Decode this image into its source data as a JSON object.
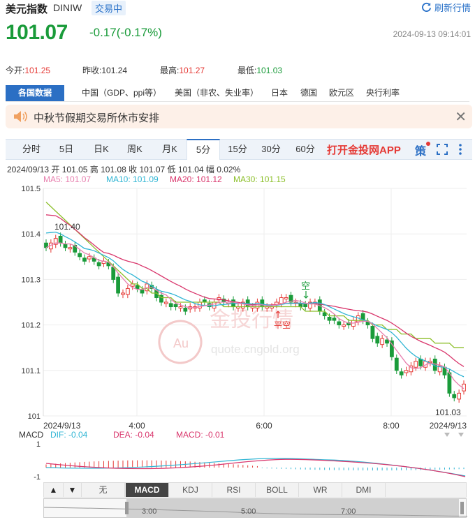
{
  "header": {
    "name": "美元指数",
    "code": "DINIW",
    "status": "交易中",
    "refresh_label": "刷新行情",
    "price": "101.07",
    "change": "-0.17(-0.17%)",
    "timestamp": "2024-09-13 09:14:01"
  },
  "stats": {
    "open_label": "今开:",
    "open": "101.25",
    "prev_label": "昨收:",
    "prev": "101.24",
    "high_label": "最高:",
    "high": "101.27",
    "low_label": "最低:",
    "low": "101.03"
  },
  "data_tabs": [
    "各国数据",
    "中国（GDP、ppi等）",
    "美国（非农、失业率）",
    "日本",
    "德国",
    "欧元区",
    "央行利率"
  ],
  "notice": {
    "text": "中秋节假期交易所休市安排"
  },
  "period_tabs": [
    "分时",
    "5日",
    "日K",
    "周K",
    "月K",
    "5分",
    "15分",
    "30分",
    "60分"
  ],
  "active_period": "5分",
  "app_link": "打开金投网APP",
  "strategy_label": "策",
  "bar_info": "2024/09/13  开 101.05  高 101.08  收 101.07  低 101.04  幅 0.02%",
  "ma_legend": {
    "ma5": "MA5: 101.07",
    "ma10": "MA10: 101.09",
    "ma20": "MA20: 101.12",
    "ma30": "MA30: 101.15"
  },
  "colors": {
    "up": "#e53935",
    "down": "#1a9b3a",
    "ma5": "#e77fae",
    "ma10": "#2fb5d4",
    "ma20": "#d9366c",
    "ma30": "#8cbf2a",
    "accent": "#2b6fc4"
  },
  "chart_data": {
    "type": "candlestick",
    "y_ticks": [
      "101.5",
      "101.4",
      "101.3",
      "101.2",
      "101.1",
      "101"
    ],
    "ylim": [
      101.0,
      101.5
    ],
    "x_labels": [
      "2024/9/13",
      "4:00",
      "6:00",
      "8:00",
      "2024/9/13"
    ],
    "annotations": {
      "max_label": "101.40",
      "min_label": "101.03",
      "signal_short": "空",
      "signal_flat": "平空"
    },
    "watermark": "金投行情",
    "watermark_url": "quote.cngold.org",
    "closes": [
      101.37,
      101.38,
      101.39,
      101.38,
      101.37,
      101.37,
      101.36,
      101.35,
      101.34,
      101.35,
      101.34,
      101.33,
      101.34,
      101.33,
      101.3,
      101.27,
      101.27,
      101.28,
      101.29,
      101.28,
      101.27,
      101.29,
      101.28,
      101.26,
      101.25,
      101.25,
      101.24,
      101.24,
      101.24,
      101.23,
      101.24,
      101.24,
      101.25,
      101.25,
      101.24,
      101.25,
      101.26,
      101.25,
      101.25,
      101.24,
      101.24,
      101.25,
      101.24,
      101.24,
      101.25,
      101.24,
      101.24,
      101.24,
      101.25,
      101.26,
      101.26,
      101.25,
      101.25,
      101.24,
      101.24,
      101.25,
      101.25,
      101.23,
      101.22,
      101.21,
      101.21,
      101.2,
      101.2,
      101.2,
      101.21,
      101.22,
      101.21,
      101.2,
      101.17,
      101.16,
      101.17,
      101.16,
      101.13,
      101.1,
      101.09,
      101.1,
      101.11,
      101.12,
      101.11,
      101.12,
      101.12,
      101.1,
      101.11,
      101.09,
      101.05,
      101.04,
      101.05,
      101.07
    ],
    "ma30": [
      101.47,
      101.46,
      101.45,
      101.44,
      101.43,
      101.42,
      101.41,
      101.4,
      101.39,
      101.38,
      101.37,
      101.36,
      101.35,
      101.34,
      101.33,
      101.32,
      101.31,
      101.3,
      101.29,
      101.29,
      101.28,
      101.28,
      101.27,
      101.27,
      101.26,
      101.26,
      101.26,
      101.25,
      101.25,
      101.25,
      101.25,
      101.25,
      101.25,
      101.25,
      101.25,
      101.25,
      101.25,
      101.24,
      101.24,
      101.24,
      101.24,
      101.24,
      101.24,
      101.24,
      101.24,
      101.24,
      101.24,
      101.24,
      101.24,
      101.24,
      101.24,
      101.24,
      101.24,
      101.24,
      101.23,
      101.23,
      101.23,
      101.23,
      101.23,
      101.22,
      101.22,
      101.22,
      101.22,
      101.21,
      101.21,
      101.21,
      101.21,
      101.21,
      101.2,
      101.2,
      101.2,
      101.19,
      101.19,
      101.19,
      101.18,
      101.18,
      101.18,
      101.17,
      101.17,
      101.17,
      101.17,
      101.16,
      101.16,
      101.16,
      101.16,
      101.15,
      101.15,
      101.15
    ],
    "macd": {
      "dif": "DIF: -0.04",
      "dea": "DEA: -0.04",
      "macd": "MACD: -0.01",
      "y_ticks": [
        "1",
        "-1"
      ]
    }
  },
  "indicator_tabs": [
    "无",
    "MACD",
    "KDJ",
    "RSI",
    "BOLL",
    "WR",
    "DMI"
  ],
  "active_indicator": "MACD",
  "navigator_labels": [
    "3:00",
    "5:00",
    "7:00"
  ]
}
